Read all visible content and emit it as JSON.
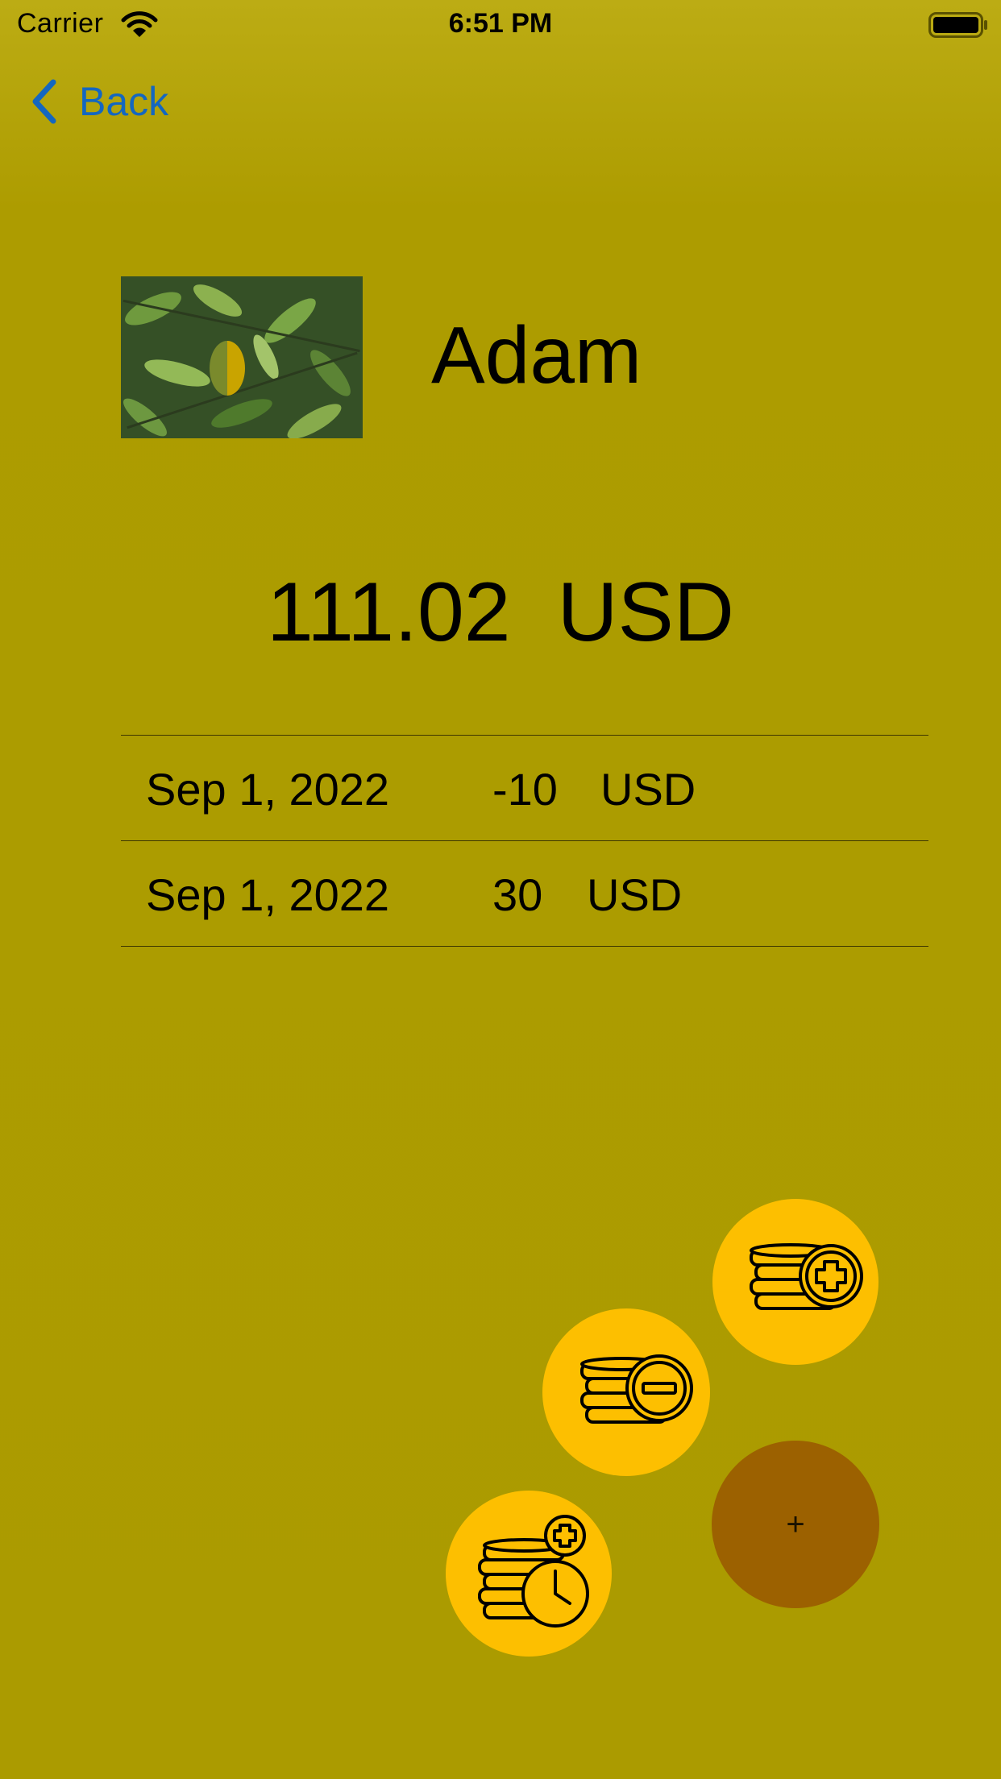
{
  "status_bar": {
    "carrier": "Carrier",
    "time": "6:51 PM"
  },
  "nav": {
    "back_label": "Back"
  },
  "profile": {
    "name": "Adam"
  },
  "balance": {
    "amount": "111.02",
    "currency": "USD"
  },
  "transactions": [
    {
      "date": "Sep 1, 2022",
      "amount": "-10",
      "currency": "USD"
    },
    {
      "date": "Sep 1, 2022",
      "amount": "30",
      "currency": "USD"
    }
  ],
  "actions": {
    "main_label": "+",
    "income_icon": "coins-plus-icon",
    "expense_icon": "coins-minus-icon",
    "scheduled_icon": "coins-clock-icon"
  },
  "colors": {
    "background": "#ad9c00",
    "accent_blue": "#1467c0",
    "action_yellow": "#fdbf00",
    "main_action_brown": "#9c6100"
  }
}
